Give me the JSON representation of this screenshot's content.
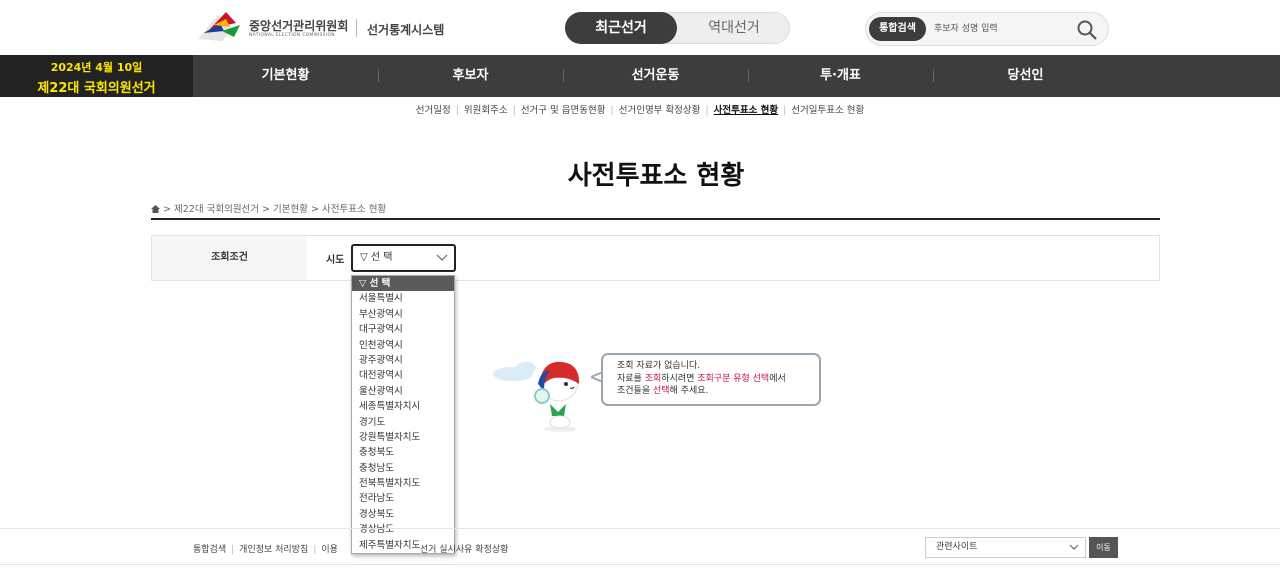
{
  "header": {
    "org_name": "중앙선거관리위원회",
    "org_sub": "NATIONAL ELECTION COMMISSION",
    "system_title": "선거통계시스템",
    "toggle": {
      "recent": "최근선거",
      "past": "역대선거"
    },
    "search": {
      "tag": "통합검색",
      "placeholder": "후보자 성명 입력"
    }
  },
  "nav": {
    "election_date": "2024년 4월 10일",
    "election_name": "제22대 국회의원선거",
    "items": [
      "기본현황",
      "후보자",
      "선거운동",
      "투·개표",
      "당선인"
    ]
  },
  "subnav": {
    "items": [
      "선거일정",
      "위원회주소",
      "선거구 및 읍면동현황",
      "선거인명부 확정상황",
      "사전투표소 현황",
      "선거일투표소 현황"
    ],
    "active_index": 4
  },
  "page": {
    "title": "사전투표소 현황",
    "breadcrumb": "> 제22대 국회의원선거 > 기본현황 > 사전투표소 현황"
  },
  "condition": {
    "label": "조회조건",
    "sido_label": "시도",
    "sido_value": "▽ 선 택",
    "options": [
      "▽ 선 택",
      "서울특별시",
      "부산광역시",
      "대구광역시",
      "인천광역시",
      "광주광역시",
      "대전광역시",
      "울산광역시",
      "세종특별자치시",
      "경기도",
      "강원특별자치도",
      "충청북도",
      "충청남도",
      "전북특별자치도",
      "전라남도",
      "경상북도",
      "경상남도",
      "제주특별자치도"
    ]
  },
  "empty": {
    "line1": "조회 자료가 없습니다.",
    "line2_a": "자료를 ",
    "line2_b": "조회",
    "line2_c": "하시려면 ",
    "line2_d": "조회구분 유형 선택",
    "line2_e": "에서",
    "line3_a": "조건들을 ",
    "line3_b": "선택",
    "line3_c": "해 주세요."
  },
  "footer": {
    "links": [
      "통합검색",
      "개인정보 처리방침",
      "이용",
      "선거 실시사유 확정상황"
    ],
    "related_label": "관련사이트",
    "go_label": "이동"
  },
  "colors": {
    "nav_bg": "#3d3d3d",
    "badge_text": "#ffe600",
    "highlight": "#c8174b"
  }
}
